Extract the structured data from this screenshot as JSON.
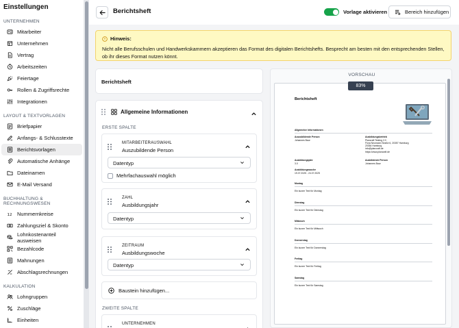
{
  "sidebar": {
    "title": "Einstellungen",
    "sections": [
      {
        "label": "UNTERNEHMEN",
        "items": [
          {
            "label": "Mitarbeiter",
            "icon": "id-card-icon"
          },
          {
            "label": "Unternehmen",
            "icon": "building-icon"
          },
          {
            "label": "Vertrag",
            "icon": "document-icon"
          },
          {
            "label": "Arbeitszeiten",
            "icon": "clock-icon"
          },
          {
            "label": "Feiertage",
            "icon": "party-icon"
          },
          {
            "label": "Rollen & Zugriffsrechte",
            "icon": "key-icon"
          },
          {
            "label": "Integrationen",
            "icon": "sliders-icon"
          }
        ]
      },
      {
        "label": "LAYOUT & TEXTVORLAGEN",
        "items": [
          {
            "label": "Briefpapier",
            "icon": "letter-icon"
          },
          {
            "label": "Anfangs- & Schlusstexte",
            "icon": "pen-icon"
          },
          {
            "label": "Berichtsvorlagen",
            "icon": "report-icon",
            "active": true
          },
          {
            "label": "Automatische Anhänge",
            "icon": "paperclip-icon"
          },
          {
            "label": "Dateinamen",
            "icon": "folder-icon"
          },
          {
            "label": "E-Mail Versand",
            "icon": "mail-icon"
          }
        ]
      },
      {
        "label": "BUCHHALTUNG & RECHNUNGSWESEN",
        "items": [
          {
            "label": "Nummernkreise",
            "icon": "numbers-icon"
          },
          {
            "label": "Zahlungsziel & Skonto",
            "icon": "money-icon"
          },
          {
            "label": "Lohnkostenanteil ausweisen",
            "icon": "coins-icon"
          },
          {
            "label": "Bezahlcode",
            "icon": "qr-code-icon"
          },
          {
            "label": "Mahnungen",
            "icon": "list-icon"
          },
          {
            "label": "Abschlagsrechnungen",
            "icon": "split-icon"
          }
        ]
      },
      {
        "label": "KALKULATION",
        "items": [
          {
            "label": "Lohngruppen",
            "icon": "user-group-icon"
          },
          {
            "label": "Zuschläge",
            "icon": "percent-icon"
          },
          {
            "label": "Einheiten",
            "icon": "ruler-icon"
          }
        ]
      }
    ]
  },
  "header": {
    "title": "Berichtsheft",
    "toggle_label": "Vorlage aktivieren",
    "toggle_on": true,
    "add_area_label": "Bereich hinzufügen"
  },
  "notice": {
    "title": "Hinweis:",
    "text_line1": "Nicht alle Berufsschulen und Handwerkskammern akzeptieren das Format des digitalen Berichtshefts. Besprecht am besten mit den entsprechenden Stellen,",
    "text_line2": "ob ihr dieses Format nutzen könnt."
  },
  "editor": {
    "name_value": "Berichtsheft",
    "group_title": "Allgemeine Informationen",
    "first_column_label": "ERSTE SPALTE",
    "second_column_label": "ZWEITE SPALTE",
    "fields": [
      {
        "kind": "MITARBEITERAUSWAHL",
        "name": "Auszubildende Person",
        "select": "Datentyp",
        "checkbox_label": "Mehrfachauswahl möglich"
      },
      {
        "kind": "ZAHL",
        "name": "Ausbildungsjahr",
        "select": "Datentyp"
      },
      {
        "kind": "ZEITRAUM",
        "name": "Ausbildungswoche",
        "select": "Datentyp"
      }
    ],
    "add_block_label": "Baustein hinzufügen...",
    "second_field_kind": "UNTERNEHMEN"
  },
  "preview": {
    "label": "VORSCHAU",
    "zoom": "83%",
    "doc": {
      "title": "Berichtsheft",
      "section": "Allgemeine Informationen",
      "azubi_label": "Auszubildende Person",
      "azubi_value": "Johannes Baur",
      "betrieb_label": "Ausbildungsbetrieb",
      "betrieb_lines": [
        "Plancraft Testing 2.0",
        "Flora Neumann Straße 6, 20357 Hamburg",
        "20354 Hamburg",
        "info@plancraft.de",
        "https://www.plancraft.de"
      ],
      "jahr_label": "Ausbildungsjahr",
      "jahr_value": "3.0",
      "ausbilder_label": "Ausbildende Person",
      "ausbilder_value": "Johannes Baur",
      "woche_label": "Ausbildungswoche",
      "woche_value": "19.07.2025 - 24.07.2025",
      "days": [
        {
          "day": "Montag",
          "text": "Ein kurzer Text für Montag"
        },
        {
          "day": "Dienstag",
          "text": "Ein kurzer Text für Dienstag"
        },
        {
          "day": "Mittwoch",
          "text": "Ein kurzer Text für Mittwoch"
        },
        {
          "day": "Donnerstag",
          "text": "Ein kurzer Text für Donnerstag"
        },
        {
          "day": "Freitag",
          "text": "Ein kurzer Text für Freitag"
        },
        {
          "day": "Samstag",
          "text": "Ein kurzer Text für Samstag"
        }
      ]
    }
  },
  "colors": {
    "toggle": "#16a34a",
    "notice_bg": "#fef9c3",
    "notice_border": "#f3d36b",
    "active_item": "#eeeeef"
  }
}
